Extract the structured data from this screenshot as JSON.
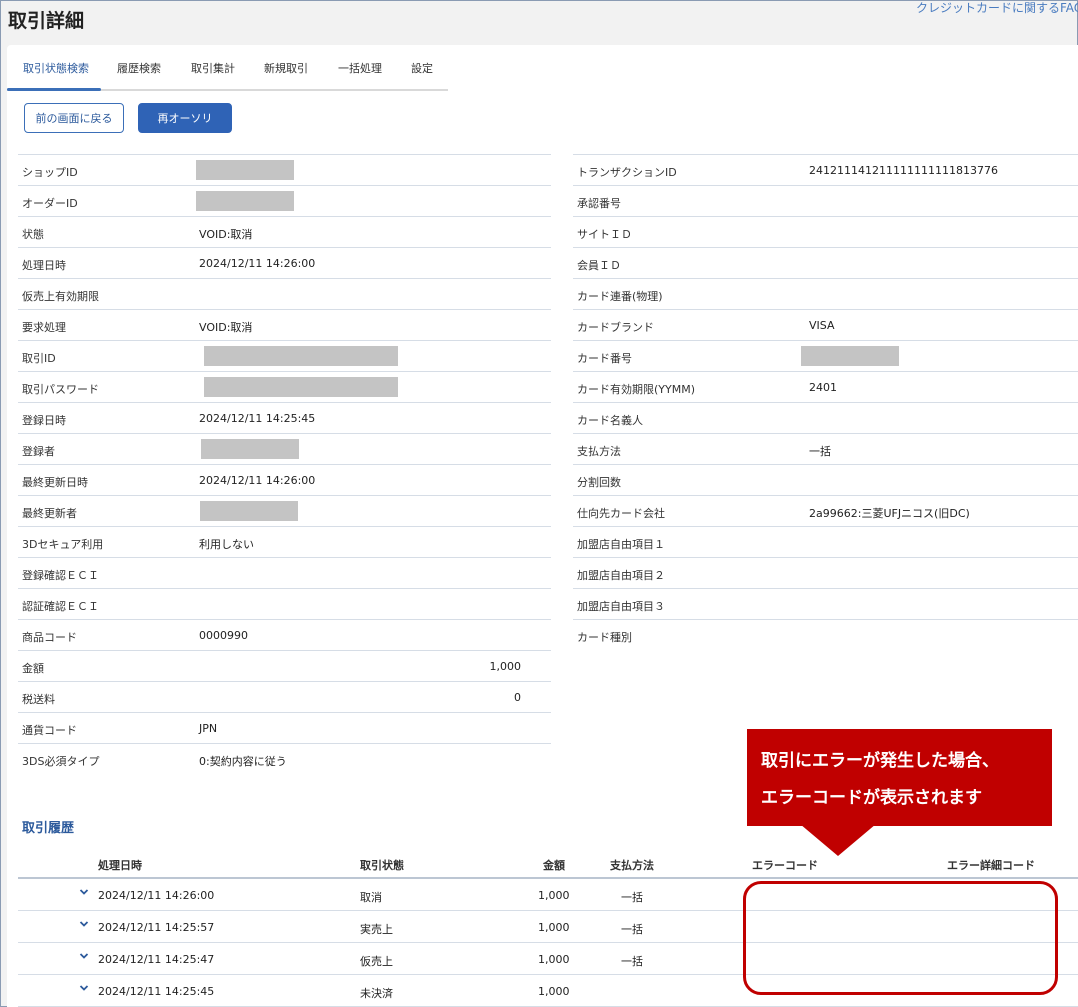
{
  "header": {
    "title": "取引詳細",
    "help_link": "クレジットカードに関するFAQ"
  },
  "tabs": [
    {
      "label": "取引状態検索",
      "active": true
    },
    {
      "label": "履歴検索",
      "active": false
    },
    {
      "label": "取引集計",
      "active": false
    },
    {
      "label": "新規取引",
      "active": false
    },
    {
      "label": "一括処理",
      "active": false
    },
    {
      "label": "設定",
      "active": false
    }
  ],
  "buttons": {
    "back_label": "前の画面に戻る",
    "reauth_label": "再オーソリ"
  },
  "details_left": [
    {
      "label": "ショップID",
      "value": "",
      "redacted": true
    },
    {
      "label": "オーダーID",
      "value": "",
      "redacted": true
    },
    {
      "label": "状態",
      "value": "VOID:取消"
    },
    {
      "label": "処理日時",
      "value": "2024/12/11 14:26:00"
    },
    {
      "label": "仮売上有効期限",
      "value": ""
    },
    {
      "label": "要求処理",
      "value": "VOID:取消"
    },
    {
      "label": "取引ID",
      "value": "",
      "redacted": true
    },
    {
      "label": "取引パスワード",
      "value": "",
      "redacted": true
    },
    {
      "label": "登録日時",
      "value": "2024/12/11 14:25:45"
    },
    {
      "label": "登録者",
      "value": "",
      "redacted": true
    },
    {
      "label": "最終更新日時",
      "value": "2024/12/11 14:26:00"
    },
    {
      "label": "最終更新者",
      "value": "",
      "redacted": true
    },
    {
      "label": "3Dセキュア利用",
      "value": "利用しない"
    },
    {
      "label": "登録確認ＥＣＩ",
      "value": ""
    },
    {
      "label": "認証確認ＥＣＩ",
      "value": ""
    },
    {
      "label": "商品コード",
      "value": "0000990"
    },
    {
      "label": "金額",
      "value": "1,000"
    },
    {
      "label": "税送料",
      "value": "0"
    },
    {
      "label": "通貨コード",
      "value": "JPN"
    },
    {
      "label": "3DS必須タイプ",
      "value": "0:契約内容に従う"
    }
  ],
  "details_right": [
    {
      "label": "トランザクションID",
      "value": "241211141211111111111813776"
    },
    {
      "label": "承認番号",
      "value": ""
    },
    {
      "label": "サイトＩＤ",
      "value": ""
    },
    {
      "label": "会員ＩＤ",
      "value": ""
    },
    {
      "label": "カード連番(物理)",
      "value": ""
    },
    {
      "label": "カードブランド",
      "value": "VISA"
    },
    {
      "label": "カード番号",
      "value": "",
      "redacted": true
    },
    {
      "label": "カード有効期限(YYMM)",
      "value": "2401"
    },
    {
      "label": "カード名義人",
      "value": ""
    },
    {
      "label": "支払方法",
      "value": "一括"
    },
    {
      "label": "分割回数",
      "value": ""
    },
    {
      "label": "仕向先カード会社",
      "value": "2a99662:三菱UFJニコス(旧DC)"
    },
    {
      "label": "加盟店自由項目１",
      "value": ""
    },
    {
      "label": "加盟店自由項目２",
      "value": ""
    },
    {
      "label": "加盟店自由項目３",
      "value": ""
    },
    {
      "label": "カード種別",
      "value": ""
    }
  ],
  "history": {
    "title": "取引履歴",
    "columns": {
      "date": "処理日時",
      "status": "取引状態",
      "amount": "金額",
      "method": "支払方法",
      "error_code": "エラーコード",
      "error_detail": "エラー詳細コード"
    },
    "rows": [
      {
        "date": "2024/12/11 14:26:00",
        "status": "取消",
        "amount": "1,000",
        "method": "一括"
      },
      {
        "date": "2024/12/11 14:25:57",
        "status": "実売上",
        "amount": "1,000",
        "method": "一括"
      },
      {
        "date": "2024/12/11 14:25:47",
        "status": "仮売上",
        "amount": "1,000",
        "method": "一括"
      },
      {
        "date": "2024/12/11 14:25:45",
        "status": "未決済",
        "amount": "1,000",
        "method": ""
      }
    ]
  },
  "callout": {
    "line1": "取引にエラーが発生した場合、",
    "line2": "エラーコードが表示されます"
  },
  "colors": {
    "accent": "#2f63b6",
    "callout": "#c00000"
  }
}
